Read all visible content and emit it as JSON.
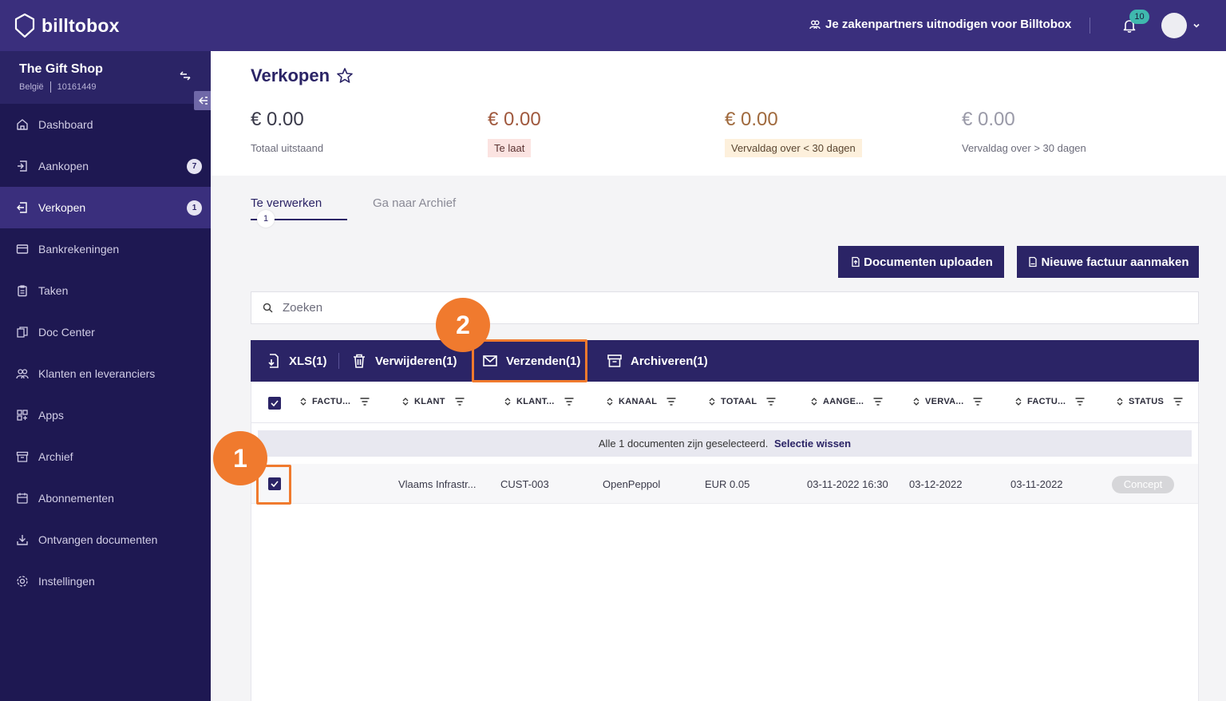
{
  "app": {
    "logo_text": "billtobox"
  },
  "topbar": {
    "invite_label": "Je zakenpartners uitnodigen voor Billtobox",
    "notification_count": "10"
  },
  "company": {
    "name": "The Gift Shop",
    "country": "België",
    "number": "10161449"
  },
  "sidebar": {
    "items": [
      {
        "label": "Dashboard",
        "icon": "home-icon"
      },
      {
        "label": "Aankopen",
        "icon": "inbox-in-icon",
        "count": "7"
      },
      {
        "label": "Verkopen",
        "icon": "inbox-out-icon",
        "count": "1",
        "active": true
      },
      {
        "label": "Bankrekeningen",
        "icon": "bank-card-icon"
      },
      {
        "label": "Taken",
        "icon": "clipboard-icon"
      },
      {
        "label": "Doc Center",
        "icon": "documents-icon"
      },
      {
        "label": "Klanten en leveranciers",
        "icon": "users-icon"
      },
      {
        "label": "Apps",
        "icon": "apps-icon"
      },
      {
        "label": "Archief",
        "icon": "archive-icon"
      },
      {
        "label": "Abonnementen",
        "icon": "calendar-icon"
      },
      {
        "label": "Ontvangen documenten",
        "icon": "download-icon"
      },
      {
        "label": "Instellingen",
        "icon": "gear-icon"
      }
    ]
  },
  "page": {
    "title": "Verkopen"
  },
  "stats": [
    {
      "amount": "€ 0.00",
      "label": "Totaal uitstaand"
    },
    {
      "amount": "€ 0.00",
      "label": "Te laat"
    },
    {
      "amount": "€ 0.00",
      "label": "Vervaldag over < 30 dagen"
    },
    {
      "amount": "€ 0.00",
      "label": "Vervaldag over > 30 dagen"
    }
  ],
  "tabs": {
    "active_label": "Te verwerken",
    "active_count": "1",
    "archive_label": "Ga naar Archief"
  },
  "actions": {
    "upload_label": "Documenten uploaden",
    "new_invoice_label": "Nieuwe factuur aanmaken"
  },
  "search": {
    "placeholder": "Zoeken"
  },
  "bulk": {
    "xls_label": "XLS(1)",
    "delete_label": "Verwijderen(1)",
    "send_label": "Verzenden(1)",
    "archive_label": "Archiveren(1)"
  },
  "steps": {
    "one": "1",
    "two": "2"
  },
  "table": {
    "columns": [
      "FACTU...",
      "KLANT",
      "KLANT...",
      "KANAAL",
      "TOTAAL",
      "AANGE...",
      "VERVA...",
      "FACTU...",
      "STATUS"
    ],
    "selection_text": "Alle 1 documenten zijn geselecteerd.",
    "selection_clear": "Selectie wissen",
    "rows": [
      {
        "invoice": "",
        "client": "Vlaams Infrastr...",
        "client_id": "CUST-003",
        "channel": "OpenPeppol",
        "total": "EUR 0.05",
        "created": "03-11-2022 16:30",
        "due": "03-12-2022",
        "invoice_date": "03-11-2022",
        "status": "Concept"
      }
    ]
  },
  "colors": {
    "brand": "#3a2f7d",
    "sidebar": "#1e1852",
    "accent_orange": "#f07a2e"
  }
}
